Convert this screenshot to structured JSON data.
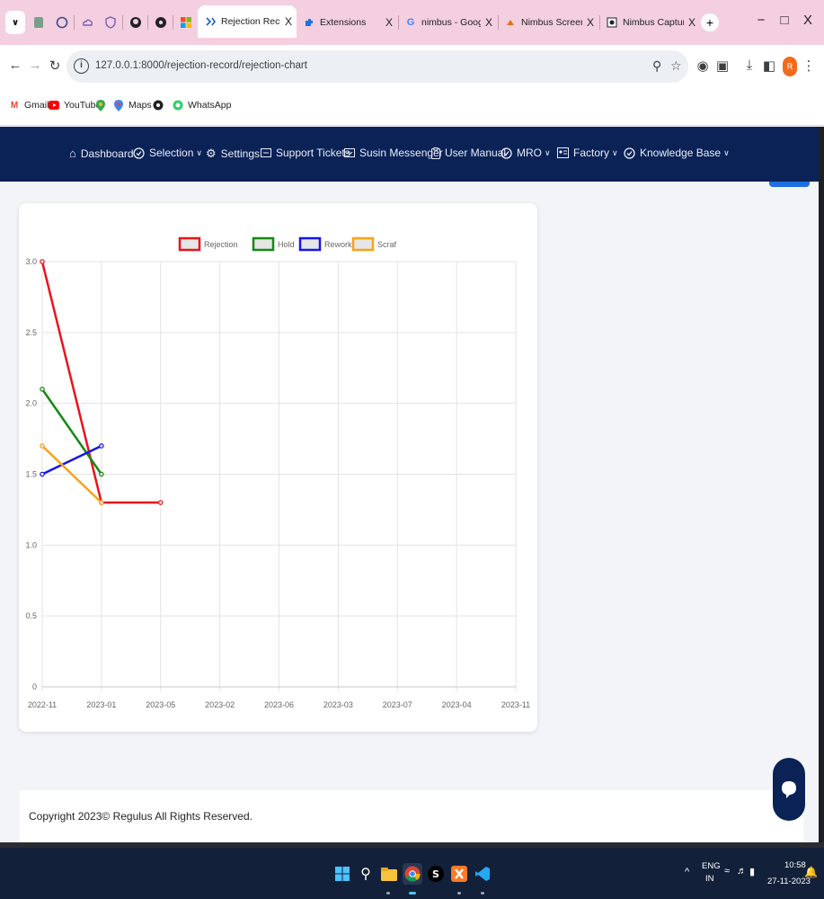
{
  "browser": {
    "tabs": [
      {
        "title": "Rejection Record Deta",
        "active": true
      },
      {
        "title": "Extensions",
        "active": false
      },
      {
        "title": "nimbus - Google Sear",
        "active": false
      },
      {
        "title": "Nimbus Screenshot &",
        "active": false
      },
      {
        "title": "Nimbus Capture Wiza",
        "active": false
      }
    ],
    "close_glyph": "X",
    "new_tab_glyph": "+",
    "window": {
      "minimize": "−",
      "maximize": "□",
      "close": "X"
    },
    "url": "127.0.0.1:8000/rejection-record/rejection-chart",
    "profile_initial": "R"
  },
  "bookmarks": [
    "Gmail",
    "YouTube",
    "Maps",
    "WhatsApp"
  ],
  "nav": {
    "items": [
      {
        "label": "Dashboard",
        "icon": "home-icon",
        "dropdown": false
      },
      {
        "label": "Selection",
        "icon": "check-circle-icon",
        "dropdown": true
      },
      {
        "label": "Settings",
        "icon": "gear-icon",
        "dropdown": false
      },
      {
        "label": "Support Tickets",
        "icon": "ticket-icon",
        "dropdown": false
      },
      {
        "label": "Susin Messenger",
        "icon": "message-icon",
        "dropdown": false
      },
      {
        "label": "User Manual",
        "icon": "clipboard-icon",
        "dropdown": false
      },
      {
        "label": "MRO",
        "icon": "check-circle-icon",
        "dropdown": true
      },
      {
        "label": "Factory",
        "icon": "id-card-icon",
        "dropdown": true
      },
      {
        "label": "Knowledge Base",
        "icon": "check-circle-icon",
        "dropdown": true
      }
    ],
    "chevron": "∨"
  },
  "chart_data": {
    "type": "line",
    "categories": [
      "2022-11",
      "2023-01",
      "2023-05",
      "2023-02",
      "2023-06",
      "2023-03",
      "2023-07",
      "2023-04",
      "2023-11"
    ],
    "ylim": [
      0,
      3
    ],
    "yticks": [
      "0",
      "0.5",
      "1.0",
      "1.5",
      "2.0",
      "2.5",
      "3.0"
    ],
    "grid": true,
    "legend_position": "top-center",
    "series": [
      {
        "name": "Rejection",
        "color": "#e8141b",
        "values": [
          3.0,
          1.3,
          1.3
        ]
      },
      {
        "name": "Hold",
        "color": "#138a13",
        "values": [
          2.1,
          1.5
        ]
      },
      {
        "name": "Rework",
        "color": "#1515ee",
        "values": [
          1.5,
          1.7
        ]
      },
      {
        "name": "Scraf",
        "color": "#fba21a",
        "values": [
          1.7,
          1.3
        ]
      }
    ]
  },
  "footer": {
    "text": "Copyright 2023© Regulus All Rights Reserved."
  },
  "taskbar": {
    "lang_top": "ENG",
    "lang_bottom": "IN",
    "time": "10:58",
    "date": "27-11-2023",
    "tray_chevron": "^"
  }
}
